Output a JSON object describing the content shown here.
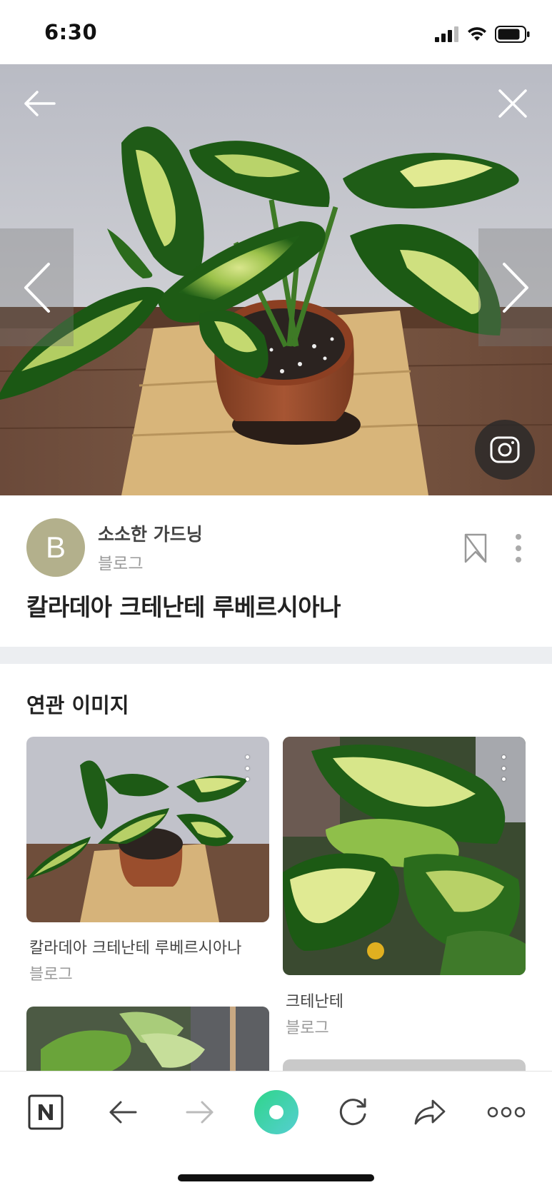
{
  "status_bar": {
    "time": "6:30"
  },
  "hero": {
    "alt": "칼라데아 크테난테 루베르시아나 plant photo"
  },
  "source": {
    "avatar_letter": "B",
    "name": "소소한 가드닝",
    "type": "블로그"
  },
  "image_title": "칼라데아 크테난테 루베르시아나",
  "related": {
    "heading": "연관 이미지",
    "items": [
      {
        "title": "칼라데아 크테난테 루베르시아나",
        "source": "블로그"
      },
      {
        "title": "크테난테",
        "source": "블로그"
      }
    ]
  },
  "toolbar": {
    "items": [
      "naver-home",
      "back",
      "forward",
      "green-dot",
      "reload",
      "share",
      "more"
    ]
  },
  "colors": {
    "avatar": "#b3b08c",
    "divider": "#eceef1",
    "green_dot_start": "#34d399",
    "green_dot_end": "#4fd1c5"
  }
}
